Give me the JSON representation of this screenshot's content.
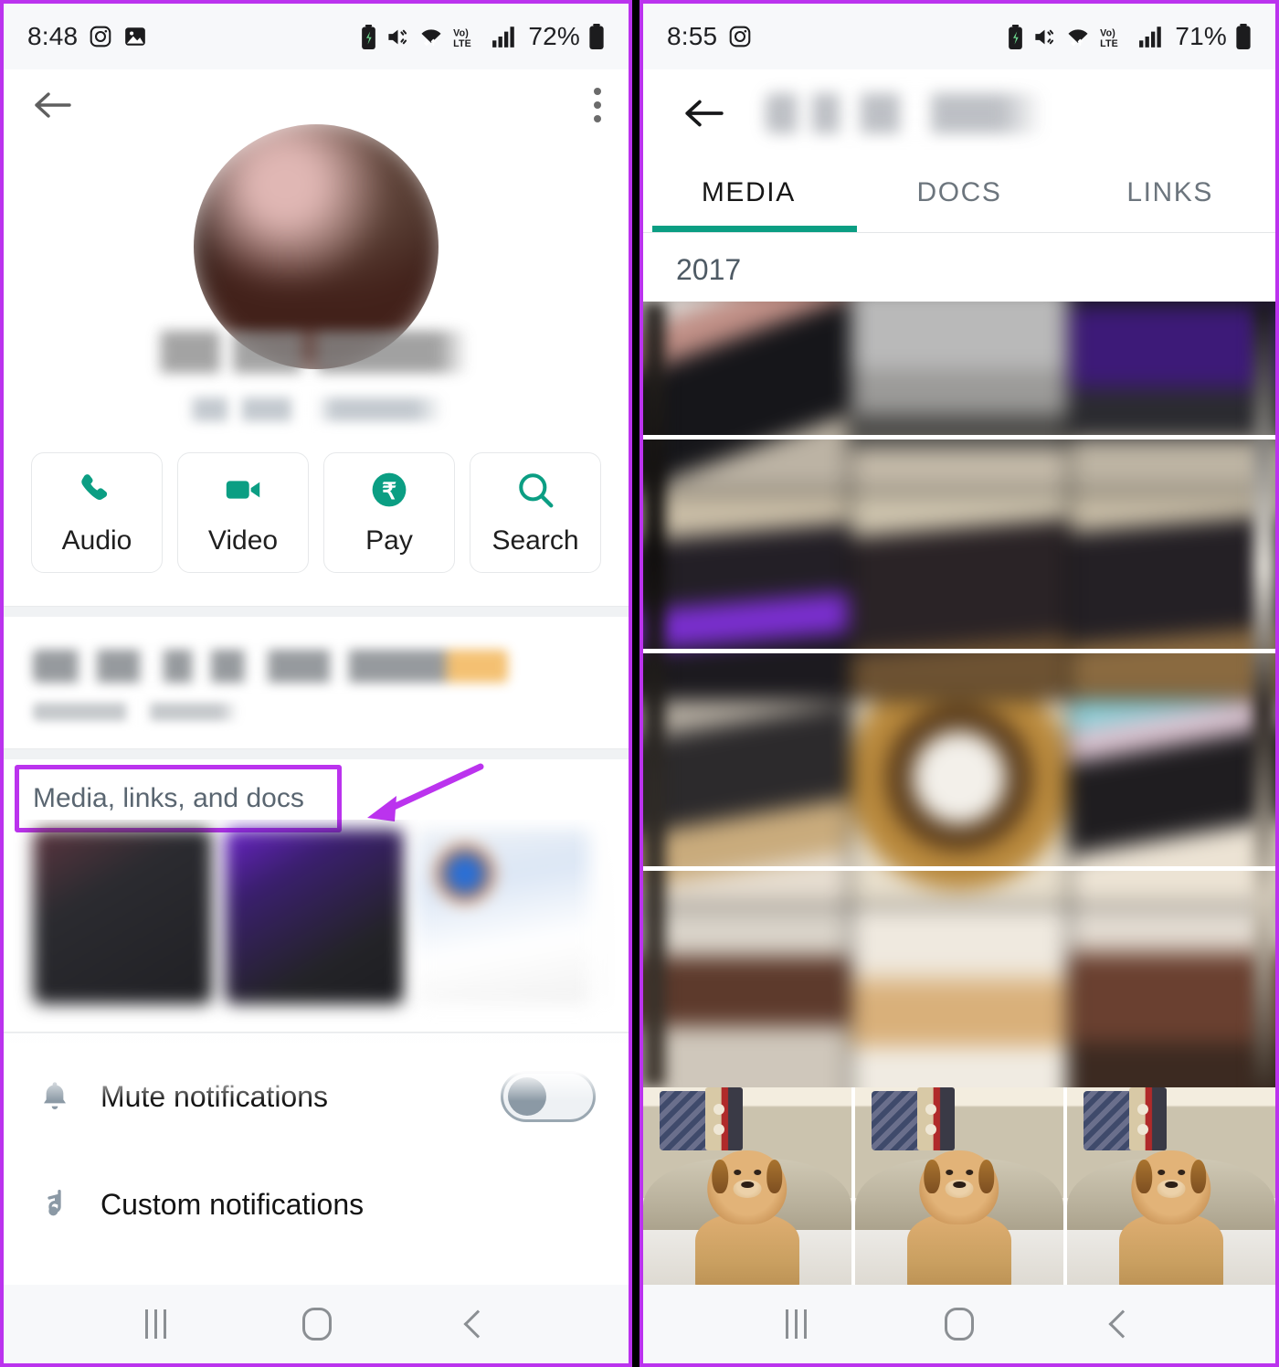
{
  "theme": {
    "accent_teal": "#0b9e83",
    "highlight_purple": "#bb33ee",
    "statusbar_bg": "#f7f8fa",
    "text_primary": "#141414",
    "text_secondary": "#5a6671"
  },
  "left_phone": {
    "status_bar": {
      "time": "8:48",
      "battery_percent": "72%",
      "icons": [
        "instagram-icon",
        "photos-icon",
        "battery-saver-icon",
        "mute-icon",
        "wifi-icon",
        "volte-icon",
        "signal-icon",
        "battery-icon"
      ]
    },
    "topbar": {
      "back_icon": "back-arrow-icon",
      "overflow_icon": "kebab-menu-icon"
    },
    "profile": {
      "avatar": "contact-avatar",
      "name": "",
      "phone_number": "",
      "name_redacted": true,
      "phone_redacted": true
    },
    "actions": [
      {
        "id": "audio",
        "label": "Audio",
        "icon": "phone-icon"
      },
      {
        "id": "video",
        "label": "Video",
        "icon": "video-camera-icon"
      },
      {
        "id": "pay",
        "label": "Pay",
        "icon": "rupee-pay-icon"
      },
      {
        "id": "search",
        "label": "Search",
        "icon": "search-icon"
      }
    ],
    "about": {
      "status_text": "",
      "status_redacted": true,
      "timestamp_text": "",
      "timestamp_redacted": true
    },
    "media_section": {
      "label": "Media, links, and docs",
      "highlighted": true,
      "arrow_annotation": "purple-arrow-pointing-left",
      "thumbnails": [
        "thumb-dark-red",
        "thumb-purple",
        "thumb-white-chat",
        "thumb-light"
      ]
    },
    "settings_rows": [
      {
        "id": "mute-notifications",
        "label": "Mute notifications",
        "icon": "bell-icon",
        "toggle": "off"
      },
      {
        "id": "custom-notifications",
        "label": "Custom notifications",
        "icon": "music-note-icon",
        "toggle": null
      }
    ],
    "navbar": {
      "recents_icon": "recents-icon",
      "home_icon": "home-icon",
      "back_icon": "nav-back-icon"
    }
  },
  "right_phone": {
    "status_bar": {
      "time": "8:55",
      "battery_percent": "71%",
      "icons": [
        "instagram-icon",
        "battery-saver-icon",
        "mute-icon",
        "wifi-icon",
        "volte-icon",
        "signal-icon",
        "battery-icon"
      ]
    },
    "topbar": {
      "back_icon": "back-arrow-icon",
      "title": "",
      "title_redacted": true
    },
    "tabs": [
      {
        "id": "media",
        "label": "MEDIA",
        "active": true
      },
      {
        "id": "docs",
        "label": "DOCS",
        "active": false
      },
      {
        "id": "links",
        "label": "LINKS",
        "active": false
      }
    ],
    "year_header": "2017",
    "grid": {
      "columns": 3,
      "rows": 4,
      "blurred": true,
      "cells": [
        "photo-person-dark",
        "photo-gray-indoor",
        "photo-purple-screen",
        "photo-purple-group",
        "photo-dark-group",
        "photo-dark-room",
        "photo-dark-frame",
        "photo-gold-mirror",
        "photo-framed-picture",
        "photo-blurred-a",
        "photo-blurred-b",
        "photo-blurred-c"
      ]
    },
    "bottom_row": [
      {
        "id": "dog-photo-1",
        "alt": "dog-on-sofa",
        "selected": false
      },
      {
        "id": "dog-photo-2",
        "alt": "dog-on-sofa",
        "selected": false
      },
      {
        "id": "dog-photo-3",
        "alt": "dog-on-sofa",
        "selected": true
      }
    ],
    "navbar": {
      "recents_icon": "recents-icon",
      "home_icon": "home-icon",
      "back_icon": "nav-back-icon"
    }
  }
}
